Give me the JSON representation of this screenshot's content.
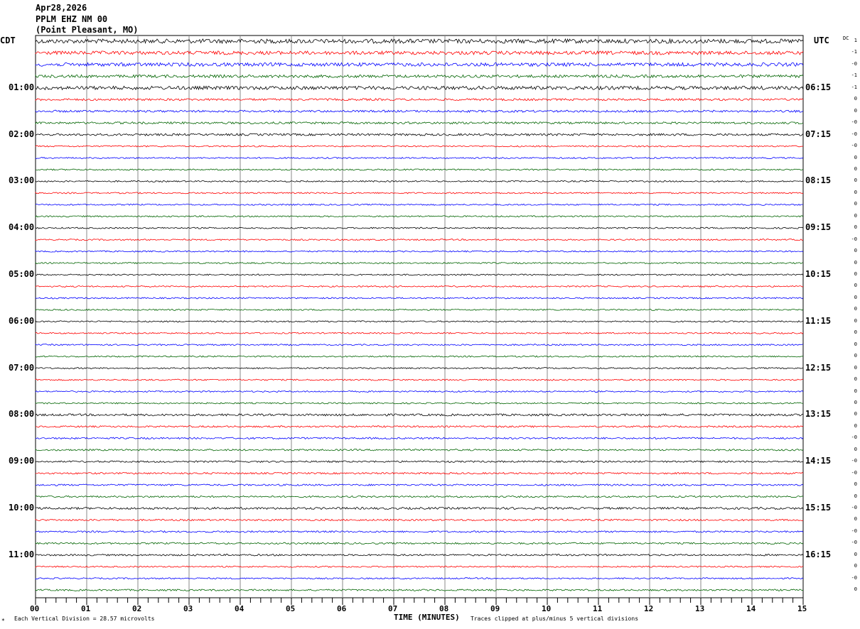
{
  "header": {
    "date": "Apr28,2026",
    "station": "PPLM EHZ NM 00",
    "location": "(Point Pleasant, MO)"
  },
  "left_tz": "CDT",
  "right_tz": "UTC",
  "dc_label": "DC",
  "chart_data": {
    "type": "line",
    "title": "PPLM EHZ NM 00 helicorder",
    "xlabel": "TIME (MINUTES)",
    "xlim": [
      0,
      15
    ],
    "x_ticks": [
      "00",
      "01",
      "02",
      "03",
      "04",
      "05",
      "06",
      "07",
      "08",
      "09",
      "10",
      "11",
      "12",
      "13",
      "14",
      "15"
    ],
    "trace_count": 48,
    "trace_colors": [
      "#000000",
      "#ff0000",
      "#0000ff",
      "#006400"
    ],
    "left_hour_labels": [
      "01:00",
      "02:00",
      "03:00",
      "04:00",
      "05:00",
      "06:00",
      "07:00",
      "08:00",
      "09:00",
      "10:00",
      "11:00"
    ],
    "right_hour_labels": [
      "06:15",
      "07:15",
      "08:15",
      "09:15",
      "10:15",
      "11:15",
      "12:15",
      "13:15",
      "14:15",
      "15:15",
      "16:15"
    ],
    "dc_offsets": [
      "1",
      "-1",
      "-0",
      "-1",
      "-1",
      "0",
      "0",
      "-0",
      "-0",
      "-0",
      "0",
      "0",
      "0",
      "0",
      "0",
      "0",
      "0",
      "-0",
      "0",
      "0",
      "0",
      "0",
      "0",
      "0",
      "0",
      "0",
      "0",
      "0",
      "0",
      "0",
      "0",
      "0",
      "0",
      "0",
      "-0",
      "0",
      "-0",
      "-0",
      "0",
      "0",
      "-0",
      "0",
      "-0",
      "-0",
      "0",
      "0",
      "-0",
      "0"
    ],
    "trace_noise_level": [
      3,
      2.5,
      2.5,
      2,
      2.5,
      1.5,
      1.5,
      1.5,
      1.5,
      1,
      1,
      1,
      1,
      1,
      1,
      1,
      1,
      1,
      1,
      1,
      1,
      1,
      1,
      1,
      1,
      1,
      1,
      1,
      1,
      1,
      1,
      1,
      1.5,
      1.2,
      1.2,
      1.2,
      1.2,
      1.2,
      1.2,
      1.2,
      1.5,
      1.2,
      1.2,
      1.2,
      1.2,
      1,
      1,
      1.2
    ]
  },
  "footer": {
    "scale_note": "Each Vertical Division =   28.57 microvolts",
    "clip_note": "Traces clipped at plus/minus 5 vertical divisions",
    "corner_mark": "*"
  }
}
